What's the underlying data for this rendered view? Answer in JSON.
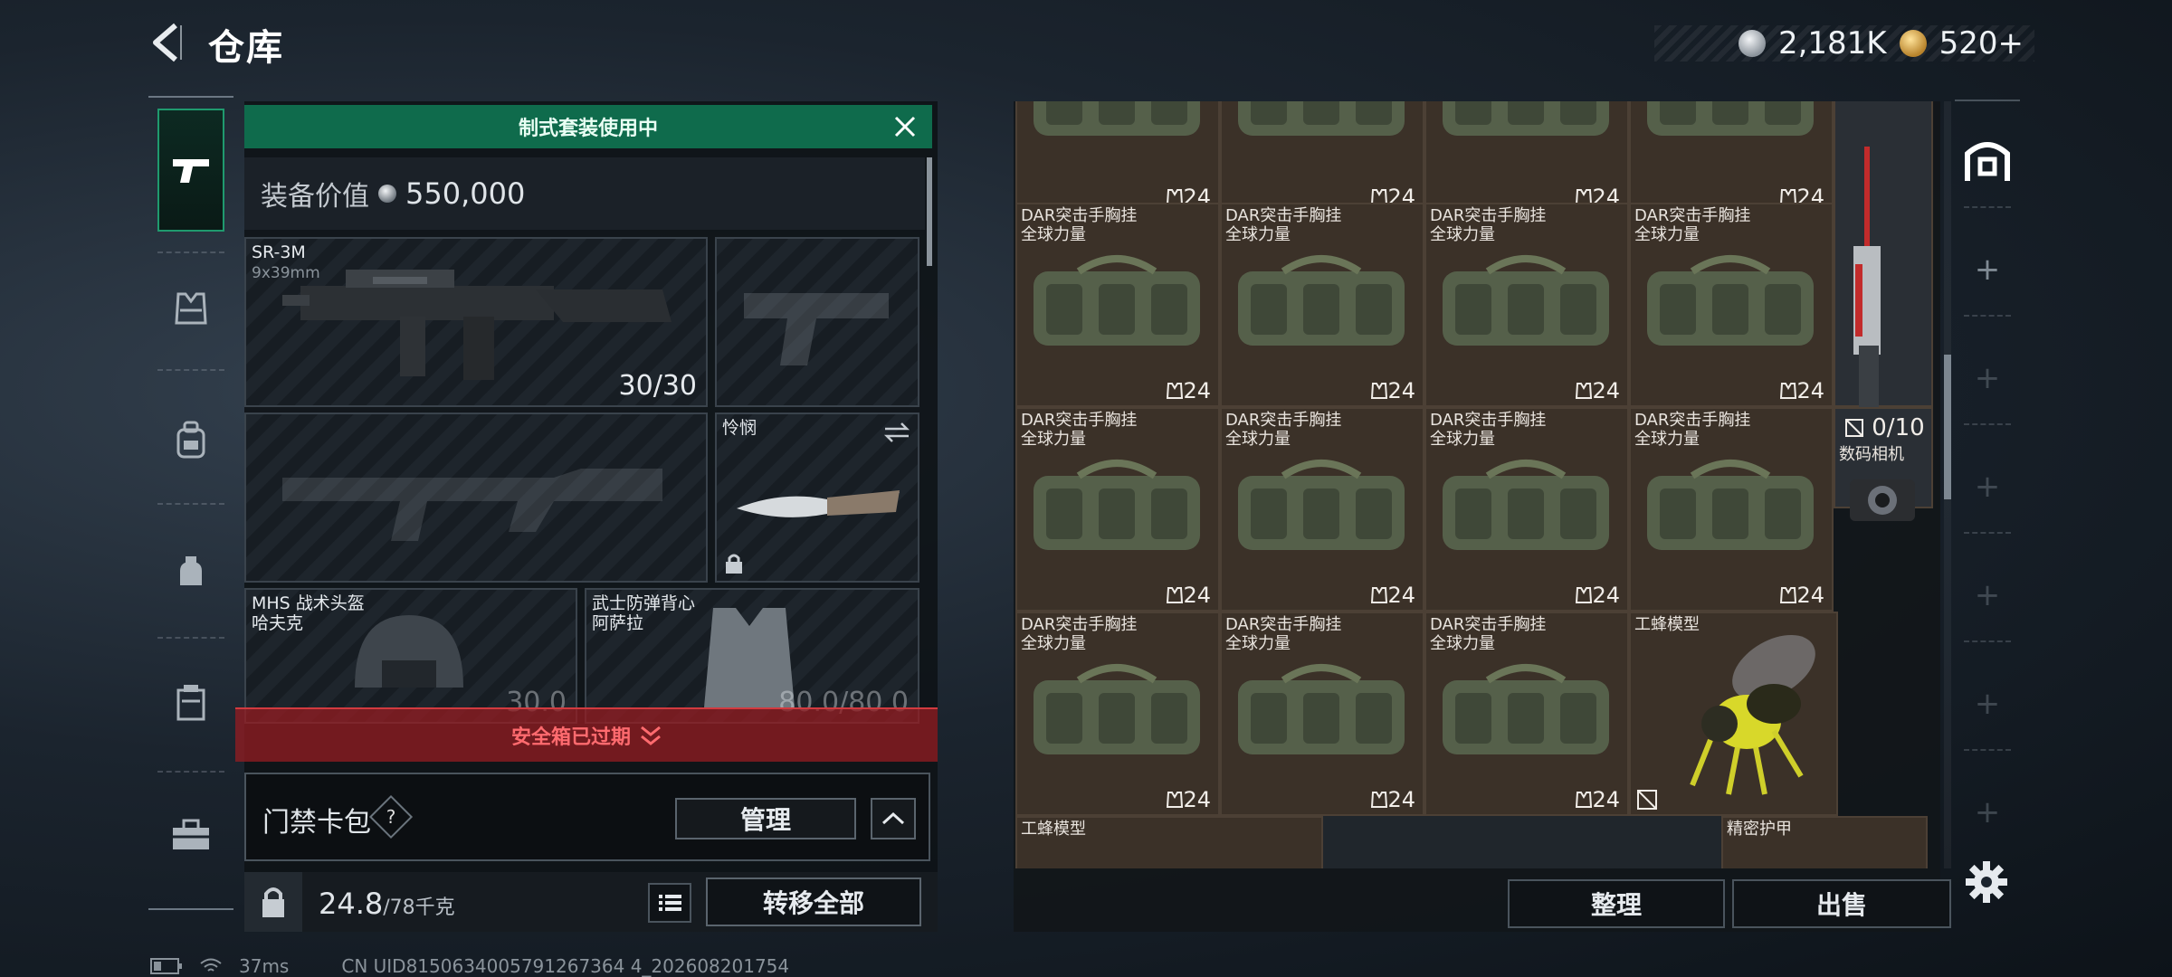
{
  "header": {
    "title": "仓库"
  },
  "currency": [
    {
      "icon": "silver-coin-icon",
      "value": "2,181K",
      "color": "#c9ced4"
    },
    {
      "icon": "gold-bond-icon",
      "value": "520+",
      "color": "#e3b24a"
    }
  ],
  "nav": {
    "items": [
      {
        "icon": "gun-icon",
        "selected": true
      },
      {
        "icon": "vest-icon"
      },
      {
        "icon": "backpack-icon"
      },
      {
        "icon": "helmet-bag-icon"
      },
      {
        "icon": "armor-plate-icon"
      },
      {
        "icon": "toolbox-icon"
      }
    ]
  },
  "loadout": {
    "banner": "制式套装使用中",
    "value_label": "装备价值",
    "value": "550,000",
    "primary": {
      "name": "SR-3M",
      "caliber": "9x39mm",
      "ammo": "30/30"
    },
    "melee": {
      "name": "怜悯"
    },
    "helmet": {
      "name": "MHS 战术头盔\n哈夫克",
      "durability": "30.0"
    },
    "armor": {
      "name": "武士防弹背心\n阿萨拉",
      "durability": "80.0/80.0"
    },
    "expired": "安全箱已过期",
    "keycard_label": "门禁卡包",
    "help": "?",
    "manage": "管理",
    "weight": "24.8",
    "weight_max": "/78千克",
    "transfer": "转移全部"
  },
  "storage": {
    "item_name": "DAR突击手胸挂\n全球力量",
    "qty": "24",
    "camera": {
      "count": "0/10",
      "name": "数码相机"
    },
    "bee": {
      "name": "工蜂模型"
    },
    "bee2": {
      "name": "工蜂模型"
    },
    "armor": {
      "name": "精密护甲"
    },
    "sort": "整理",
    "sell": "出售"
  },
  "status": {
    "ping": "37ms",
    "uid": "CN UID8150634005791267364 4_202608201754"
  }
}
